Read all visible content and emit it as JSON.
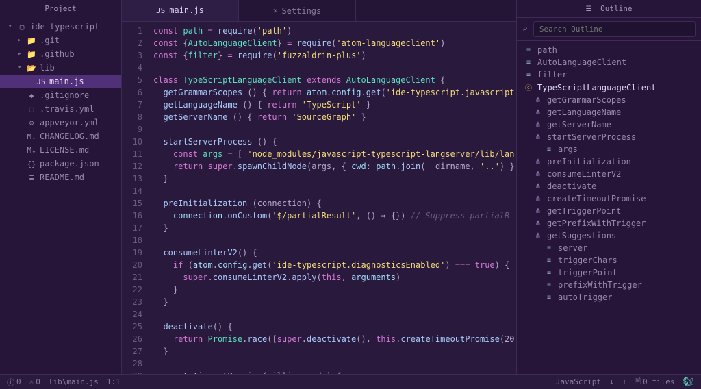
{
  "sidebar": {
    "title": "Project",
    "root": {
      "label": "ide-typescript",
      "icon": "▢"
    },
    "items": [
      {
        "label": ".git",
        "icon": "📁",
        "depth": 1,
        "collapsed": true
      },
      {
        "label": ".github",
        "icon": "📁",
        "depth": 1,
        "collapsed": true
      },
      {
        "label": "lib",
        "icon": "📂",
        "depth": 1,
        "collapsed": false
      },
      {
        "label": "main.js",
        "icon": "JS",
        "depth": 2,
        "selected": true
      },
      {
        "label": ".gitignore",
        "icon": "◆",
        "depth": 1
      },
      {
        "label": ".travis.yml",
        "icon": "⬚",
        "depth": 1
      },
      {
        "label": "appveyor.yml",
        "icon": "⊙",
        "depth": 1
      },
      {
        "label": "CHANGELOG.md",
        "icon": "M↓",
        "depth": 1
      },
      {
        "label": "LICENSE.md",
        "icon": "M↓",
        "depth": 1
      },
      {
        "label": "package.json",
        "icon": "{}",
        "depth": 1
      },
      {
        "label": "README.md",
        "icon": "≣",
        "depth": 1
      }
    ]
  },
  "tabs": [
    {
      "label": "main.js",
      "icon": "JS",
      "active": true
    },
    {
      "label": "Settings",
      "icon": "✕",
      "active": false
    }
  ],
  "code_lines": [
    {
      "n": 1,
      "html": "<span class='kw'>const</span> <span class='def'>path</span> <span class='op'>=</span> <span class='fn'>require</span><span class='punc'>(</span><span class='str'>'path'</span><span class='punc'>)</span>"
    },
    {
      "n": 2,
      "html": "<span class='kw'>const</span> <span class='punc'>{</span><span class='def'>AutoLanguageClient</span><span class='punc'>}</span> <span class='op'>=</span> <span class='fn'>require</span><span class='punc'>(</span><span class='str'>'atom-languageclient'</span><span class='punc'>)</span>"
    },
    {
      "n": 3,
      "html": "<span class='kw'>const</span> <span class='punc'>{</span><span class='def'>filter</span><span class='punc'>}</span> <span class='op'>=</span> <span class='fn'>require</span><span class='punc'>(</span><span class='str'>'fuzzaldrin-plus'</span><span class='punc'>)</span>"
    },
    {
      "n": 4,
      "html": ""
    },
    {
      "n": 5,
      "html": "<span class='kw'>class</span> <span class='def'>TypeScriptLanguageClient</span> <span class='kw'>extends</span> <span class='def'>AutoLanguageClient</span> <span class='punc'>{</span>"
    },
    {
      "n": 6,
      "html": "  <span class='fn'>getGrammarScopes</span> <span class='punc'>() {</span> <span class='kw'>return</span> <span class='prop'>atom</span><span class='punc'>.</span><span class='prop'>config</span><span class='punc'>.</span><span class='fn'>get</span><span class='punc'>(</span><span class='str'>'ide-typescript.javascript'</span>"
    },
    {
      "n": 7,
      "html": "  <span class='fn'>getLanguageName</span> <span class='punc'>() {</span> <span class='kw'>return</span> <span class='str'>'TypeScript'</span> <span class='punc'>}</span>"
    },
    {
      "n": 8,
      "html": "  <span class='fn'>getServerName</span> <span class='punc'>() {</span> <span class='kw'>return</span> <span class='str'>'SourceGraph'</span> <span class='punc'>}</span>"
    },
    {
      "n": 9,
      "html": ""
    },
    {
      "n": 10,
      "html": "  <span class='fn'>startServerProcess</span> <span class='punc'>() {</span>"
    },
    {
      "n": 11,
      "html": "    <span class='kw'>const</span> <span class='def'>args</span> <span class='op'>=</span> <span class='punc'>[</span> <span class='str'>'node_modules/javascript-typescript-langserver/lib/lan</span>"
    },
    {
      "n": 12,
      "html": "    <span class='kw'>return</span> <span class='kw'>super</span><span class='punc'>.</span><span class='fn'>spawnChildNode</span><span class='punc'>(</span>args<span class='punc'>, {</span> <span class='prop'>cwd</span><span class='punc'>:</span> <span class='prop'>path</span><span class='punc'>.</span><span class='fn'>join</span><span class='punc'>(</span>__dirname<span class='punc'>,</span> <span class='str'>'..'</span><span class='punc'>) }</span>"
    },
    {
      "n": 13,
      "html": "  <span class='punc'>}</span>"
    },
    {
      "n": 14,
      "html": ""
    },
    {
      "n": 15,
      "html": "  <span class='fn'>preInitialization</span> <span class='punc'>(</span>connection<span class='punc'>) {</span>"
    },
    {
      "n": 16,
      "html": "    <span class='prop'>connection</span><span class='punc'>.</span><span class='fn'>onCustom</span><span class='punc'>(</span><span class='str'>'$/partialResult'</span><span class='punc'>, () ⇒ {})</span> <span class='com'>// Suppress partialR</span>"
    },
    {
      "n": 17,
      "html": "  <span class='punc'>}</span>"
    },
    {
      "n": 18,
      "html": ""
    },
    {
      "n": 19,
      "html": "  <span class='fn'>consumeLinterV2</span><span class='punc'>() {</span>"
    },
    {
      "n": 20,
      "html": "    <span class='kw'>if</span> <span class='punc'>(</span><span class='prop'>atom</span><span class='punc'>.</span><span class='prop'>config</span><span class='punc'>.</span><span class='fn'>get</span><span class='punc'>(</span><span class='str'>'ide-typescript.diagnosticsEnabled'</span><span class='punc'>)</span> <span class='op'>===</span> <span class='kw'>true</span><span class='punc'>) {</span>"
    },
    {
      "n": 21,
      "html": "      <span class='kw'>super</span><span class='punc'>.</span><span class='fn'>consumeLinterV2</span><span class='punc'>.</span><span class='fn'>apply</span><span class='punc'>(</span><span class='kw'>this</span><span class='punc'>,</span> <span class='prop'>arguments</span><span class='punc'>)</span>"
    },
    {
      "n": 22,
      "html": "    <span class='punc'>}</span>"
    },
    {
      "n": 23,
      "html": "  <span class='punc'>}</span>"
    },
    {
      "n": 24,
      "html": ""
    },
    {
      "n": 25,
      "html": "  <span class='fn'>deactivate</span><span class='punc'>() {</span>"
    },
    {
      "n": 26,
      "html": "    <span class='kw'>return</span> <span class='def'>Promise</span><span class='punc'>.</span><span class='fn'>race</span><span class='punc'>([</span><span class='kw'>super</span><span class='punc'>.</span><span class='fn'>deactivate</span><span class='punc'>(),</span> <span class='kw'>this</span><span class='punc'>.</span><span class='fn'>createTimeoutPromise</span><span class='punc'>(</span>20"
    },
    {
      "n": 27,
      "html": "  <span class='punc'>}</span>"
    },
    {
      "n": 28,
      "html": ""
    },
    {
      "n": 29,
      "html": "  <span class='fn'>createTimeoutPromise</span><span class='punc'>(</span>milliseconds<span class='punc'>) {</span>"
    }
  ],
  "outline": {
    "title": "Outline",
    "search_placeholder": "Search Outline",
    "items": [
      {
        "label": "path",
        "icon": "≡",
        "kind": "var",
        "depth": 0
      },
      {
        "label": "AutoLanguageClient",
        "icon": "≡",
        "kind": "var",
        "depth": 0
      },
      {
        "label": "filter",
        "icon": "≡",
        "kind": "var",
        "depth": 0
      },
      {
        "label": "TypeScriptLanguageClient",
        "icon": "ⓒ",
        "kind": "cls",
        "depth": 0,
        "selected": true
      },
      {
        "label": "getGrammarScopes",
        "icon": "⋔",
        "kind": "meth",
        "depth": 1
      },
      {
        "label": "getLanguageName",
        "icon": "⋔",
        "kind": "meth",
        "depth": 1
      },
      {
        "label": "getServerName",
        "icon": "⋔",
        "kind": "meth",
        "depth": 1
      },
      {
        "label": "startServerProcess",
        "icon": "⋔",
        "kind": "meth",
        "depth": 1
      },
      {
        "label": "args",
        "icon": "≡",
        "kind": "var",
        "depth": 2
      },
      {
        "label": "preInitialization",
        "icon": "⋔",
        "kind": "meth",
        "depth": 1
      },
      {
        "label": "consumeLinterV2",
        "icon": "⋔",
        "kind": "meth",
        "depth": 1
      },
      {
        "label": "deactivate",
        "icon": "⋔",
        "kind": "meth",
        "depth": 1
      },
      {
        "label": "createTimeoutPromise",
        "icon": "⋔",
        "kind": "meth",
        "depth": 1
      },
      {
        "label": "getTriggerPoint",
        "icon": "⋔",
        "kind": "meth",
        "depth": 1
      },
      {
        "label": "getPrefixWithTrigger",
        "icon": "⋔",
        "kind": "meth",
        "depth": 1
      },
      {
        "label": "getSuggestions",
        "icon": "⋔",
        "kind": "meth",
        "depth": 1
      },
      {
        "label": "server",
        "icon": "≡",
        "kind": "var",
        "depth": 2
      },
      {
        "label": "triggerChars",
        "icon": "≡",
        "kind": "var",
        "depth": 2
      },
      {
        "label": "triggerPoint",
        "icon": "≡",
        "kind": "var",
        "depth": 2
      },
      {
        "label": "prefixWithTrigger",
        "icon": "≡",
        "kind": "var",
        "depth": 2
      },
      {
        "label": "autoTrigger",
        "icon": "≡",
        "kind": "var",
        "depth": 2
      }
    ]
  },
  "status": {
    "errors": "0",
    "warnings": "0",
    "path": "lib\\main.js",
    "cursor": "1:1",
    "language": "JavaScript",
    "files": "0 files"
  }
}
